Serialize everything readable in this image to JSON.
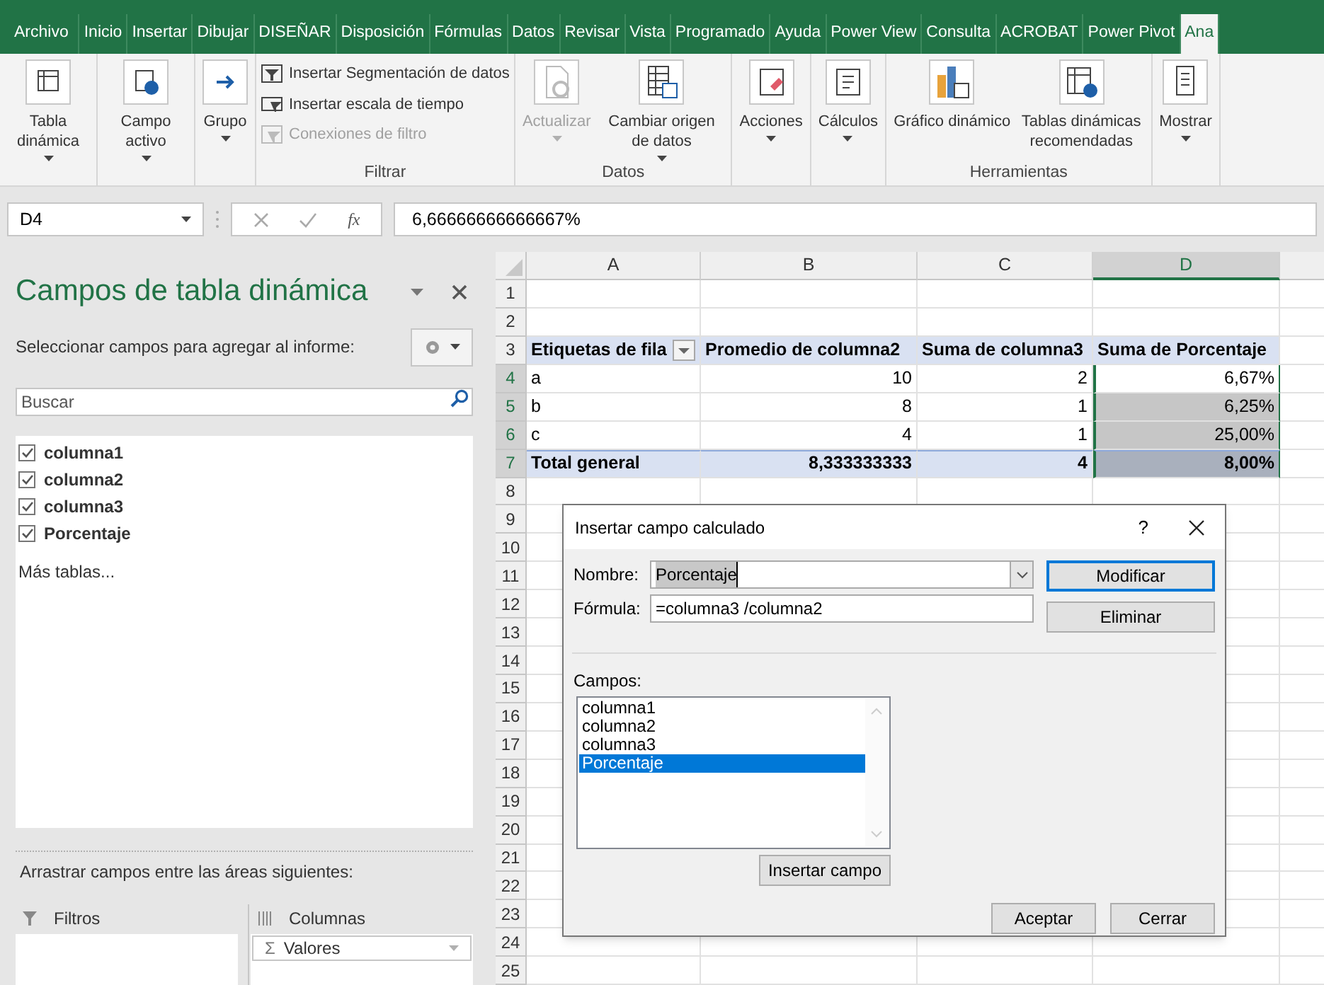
{
  "tabs": [
    {
      "label": "Archivo",
      "selected": false
    },
    {
      "label": "Inicio",
      "selected": false
    },
    {
      "label": "Insertar",
      "selected": false
    },
    {
      "label": "Dibujar",
      "selected": false
    },
    {
      "label": "DISEÑAR",
      "selected": false
    },
    {
      "label": "Disposición",
      "selected": false
    },
    {
      "label": "Fórmulas",
      "selected": false
    },
    {
      "label": "Datos",
      "selected": false
    },
    {
      "label": "Revisar",
      "selected": false
    },
    {
      "label": "Vista",
      "selected": false
    },
    {
      "label": "Programado",
      "selected": false
    },
    {
      "label": "Ayuda",
      "selected": false
    },
    {
      "label": "Power View",
      "selected": false
    },
    {
      "label": "Consulta",
      "selected": false
    },
    {
      "label": "ACROBAT",
      "selected": false
    },
    {
      "label": "Power Pivot",
      "selected": false
    },
    {
      "label": "Ana",
      "selected": true
    }
  ],
  "ribbon": [
    {
      "items": [
        {
          "kind": "large",
          "label": "Tabla dinámica",
          "caret": true,
          "disabled": false
        }
      ]
    },
    {
      "items": [
        {
          "kind": "large",
          "label": "Campo activo",
          "caret": true,
          "disabled": false
        }
      ]
    },
    {
      "items": [
        {
          "kind": "large",
          "label": "Grupo",
          "caret": true,
          "disabled": false
        }
      ]
    },
    {
      "label": "Filtrar",
      "items": [
        {
          "kind": "small",
          "label": "Insertar Segmentación de datos",
          "caret": false,
          "disabled": false
        },
        {
          "kind": "small",
          "label": "Insertar escala de tiempo",
          "caret": false,
          "disabled": false
        },
        {
          "kind": "small",
          "label": "Conexiones de filtro",
          "caret": false,
          "disabled": true
        }
      ]
    },
    {
      "label": "Datos",
      "items": [
        {
          "kind": "large",
          "label": "Actualizar",
          "caret": true,
          "disabled": true
        },
        {
          "kind": "large",
          "label": "Cambiar origen de datos",
          "caret": true,
          "disabled": false
        }
      ]
    },
    {
      "items": [
        {
          "kind": "large",
          "label": "Acciones",
          "caret": true,
          "disabled": false
        }
      ]
    },
    {
      "items": [
        {
          "kind": "large",
          "label": "Cálculos",
          "caret": true,
          "disabled": false
        }
      ]
    },
    {
      "label": "Herramientas",
      "items": [
        {
          "kind": "large",
          "label": "Gráfico dinámico",
          "caret": false,
          "disabled": false
        },
        {
          "kind": "large",
          "label": "Tablas dinámicas recomendadas",
          "caret": false,
          "disabled": false
        }
      ]
    },
    {
      "items": [
        {
          "kind": "large",
          "label": "Mostrar",
          "caret": true,
          "disabled": false
        }
      ]
    }
  ],
  "formula_bar": {
    "name_box": "D4",
    "fx_label": "fx",
    "value": "6,66666666666667%"
  },
  "field_list": {
    "title": "Campos de tabla dinámica",
    "subtitle": "Seleccionar campos para agregar al informe:",
    "search_placeholder": "Buscar",
    "fields": [
      {
        "label": "columna1",
        "checked": true
      },
      {
        "label": "columna2",
        "checked": true
      },
      {
        "label": "columna3",
        "checked": true
      },
      {
        "label": "Porcentaje",
        "checked": true
      }
    ],
    "more_tables": "Más tablas...",
    "drag_hint": "Arrastrar campos entre las áreas siguientes:",
    "areas": [
      {
        "kind": "filter",
        "label": "Filtros"
      },
      {
        "kind": "columns",
        "label": "Columnas",
        "items": [
          {
            "symbol": "Σ",
            "label": "Valores"
          }
        ]
      }
    ]
  },
  "sheet": {
    "columns": [
      {
        "label": "A",
        "selected": false
      },
      {
        "label": "B",
        "selected": false
      },
      {
        "label": "C",
        "selected": false
      },
      {
        "label": "D",
        "selected": true
      }
    ],
    "rows": [
      {
        "label": "1",
        "selected": false,
        "kind": "empty"
      },
      {
        "label": "2",
        "selected": false,
        "kind": "empty"
      },
      {
        "label": "3",
        "selected": false,
        "kind": "header",
        "cells": [
          {
            "text": "Etiquetas de fila",
            "selected": false
          },
          {
            "text": "Promedio de columna2",
            "selected": false
          },
          {
            "text": "Suma de columna3",
            "selected": false
          },
          {
            "text": "Suma de Porcentaje",
            "selected": false
          }
        ]
      },
      {
        "label": "4",
        "selected": true,
        "kind": "data",
        "cells": [
          {
            "text": "a",
            "selected": false
          },
          {
            "text": "10",
            "selected": false
          },
          {
            "text": "2",
            "selected": false
          },
          {
            "text": "6,67%",
            "selected": false
          }
        ]
      },
      {
        "label": "5",
        "selected": true,
        "kind": "data",
        "cells": [
          {
            "text": "b",
            "selected": false
          },
          {
            "text": "8",
            "selected": false
          },
          {
            "text": "1",
            "selected": false
          },
          {
            "text": "6,25%",
            "selected": true
          }
        ]
      },
      {
        "label": "6",
        "selected": true,
        "kind": "data",
        "cells": [
          {
            "text": "c",
            "selected": false
          },
          {
            "text": "4",
            "selected": false
          },
          {
            "text": "1",
            "selected": false
          },
          {
            "text": "25,00%",
            "selected": true
          }
        ]
      },
      {
        "label": "7",
        "selected": true,
        "kind": "total",
        "cells": [
          {
            "text": "Total general",
            "selected": false
          },
          {
            "text": "8,333333333",
            "selected": false
          },
          {
            "text": "4",
            "selected": false
          },
          {
            "text": "8,00%",
            "selected": true
          }
        ]
      },
      {
        "label": "8",
        "selected": false,
        "kind": "empty"
      },
      {
        "label": "9",
        "selected": false,
        "kind": "empty"
      },
      {
        "label": "10",
        "selected": false,
        "kind": "empty"
      },
      {
        "label": "11",
        "selected": false,
        "kind": "empty"
      },
      {
        "label": "12",
        "selected": false,
        "kind": "empty"
      },
      {
        "label": "13",
        "selected": false,
        "kind": "empty"
      },
      {
        "label": "14",
        "selected": false,
        "kind": "empty"
      },
      {
        "label": "15",
        "selected": false,
        "kind": "empty"
      },
      {
        "label": "16",
        "selected": false,
        "kind": "empty"
      },
      {
        "label": "17",
        "selected": false,
        "kind": "empty"
      },
      {
        "label": "18",
        "selected": false,
        "kind": "empty"
      },
      {
        "label": "19",
        "selected": false,
        "kind": "empty"
      },
      {
        "label": "20",
        "selected": false,
        "kind": "empty"
      },
      {
        "label": "21",
        "selected": false,
        "kind": "empty"
      },
      {
        "label": "22",
        "selected": false,
        "kind": "empty"
      },
      {
        "label": "23",
        "selected": false,
        "kind": "empty"
      },
      {
        "label": "24",
        "selected": false,
        "kind": "empty"
      },
      {
        "label": "25",
        "selected": false,
        "kind": "empty"
      }
    ]
  },
  "dialog": {
    "title": "Insertar campo calculado",
    "help": "?",
    "name_label": "Nombre:",
    "name_value": "Porcentaje",
    "formula_label": "Fórmula:",
    "formula_value": "=columna3 /columna2",
    "side_buttons": [
      {
        "label": "Modificar",
        "default": true
      },
      {
        "label": "Eliminar",
        "default": false
      }
    ],
    "fields_label": "Campos:",
    "fields": [
      {
        "label": "columna1",
        "selected": false
      },
      {
        "label": "columna2",
        "selected": false
      },
      {
        "label": "columna3",
        "selected": false
      },
      {
        "label": "Porcentaje",
        "selected": true
      }
    ],
    "insert_button": "Insertar campo",
    "footer_buttons": [
      {
        "label": "Aceptar",
        "default": false
      },
      {
        "label": "Cerrar",
        "default": false
      }
    ]
  }
}
